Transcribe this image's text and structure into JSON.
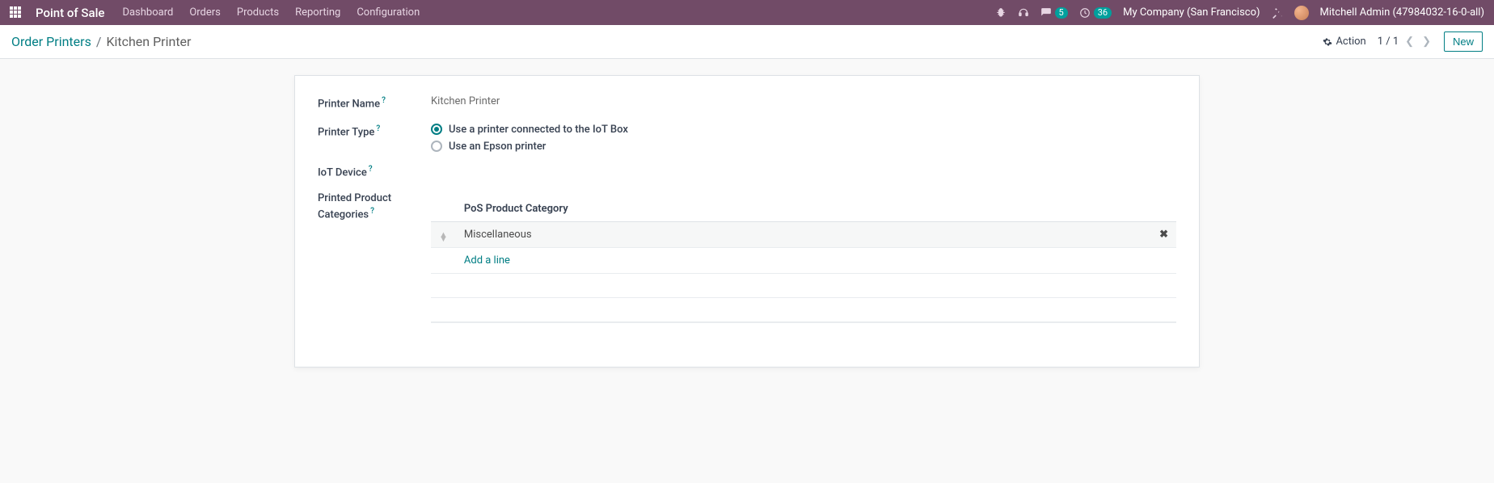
{
  "navbar": {
    "app_title": "Point of Sale",
    "menu": [
      "Dashboard",
      "Orders",
      "Products",
      "Reporting",
      "Configuration"
    ],
    "messages_count": "5",
    "activities_count": "36",
    "company": "My Company (San Francisco)",
    "username": "Mitchell Admin (47984032-16-0-all)"
  },
  "breadcrumb": {
    "parent": "Order Printers",
    "current": "Kitchen Printer"
  },
  "cp": {
    "action_label": "Action",
    "pager": "1 / 1",
    "new_label": "New"
  },
  "form": {
    "printer_name_label": "Printer Name",
    "printer_name_value": "Kitchen Printer",
    "printer_type_label": "Printer Type",
    "printer_type_options": [
      {
        "label": "Use a printer connected to the IoT Box",
        "checked": true
      },
      {
        "label": "Use an Epson printer",
        "checked": false
      }
    ],
    "iot_device_label": "IoT Device",
    "categories_label": "Printed Product Categories",
    "table": {
      "col_header": "PoS Product Category",
      "rows": [
        {
          "name": "Miscellaneous"
        }
      ],
      "add_line": "Add a line"
    }
  }
}
